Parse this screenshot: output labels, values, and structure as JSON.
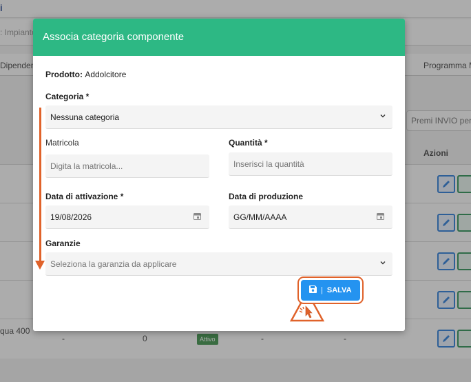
{
  "background": {
    "top_glyph": "i",
    "filter_text": ": Impianto",
    "col_left": "Dipenden",
    "col_right": "Programma M",
    "premi_label": "Premi INVIO per",
    "actions_header": "Azioni",
    "last_row": {
      "name": "qua 400",
      "c1": "-",
      "c2": "0",
      "status": "Attivo",
      "c4": "-",
      "c5": "-"
    }
  },
  "modal": {
    "title": "Associa categoria componente",
    "product_label": "Prodotto:",
    "product_value": "Addolcitore",
    "category": {
      "label": "Categoria *",
      "value": "Nessuna categoria"
    },
    "serial": {
      "label": "Matricola",
      "placeholder": "Digita la matricola..."
    },
    "quantity": {
      "label": "Quantità *",
      "placeholder": "Inserisci la quantità"
    },
    "activation_date": {
      "label": "Data di attivazione *",
      "value": "19/08/2026"
    },
    "production_date": {
      "label": "Data di produzione",
      "placeholder": "GG/MM/AAAA"
    },
    "warranty": {
      "label": "Garanzie",
      "placeholder": "Seleziona la garanzia da applicare"
    },
    "save_label": "SALVA"
  },
  "colors": {
    "header": "#2db884",
    "primary": "#2493f0",
    "annotation": "#e0622a"
  }
}
